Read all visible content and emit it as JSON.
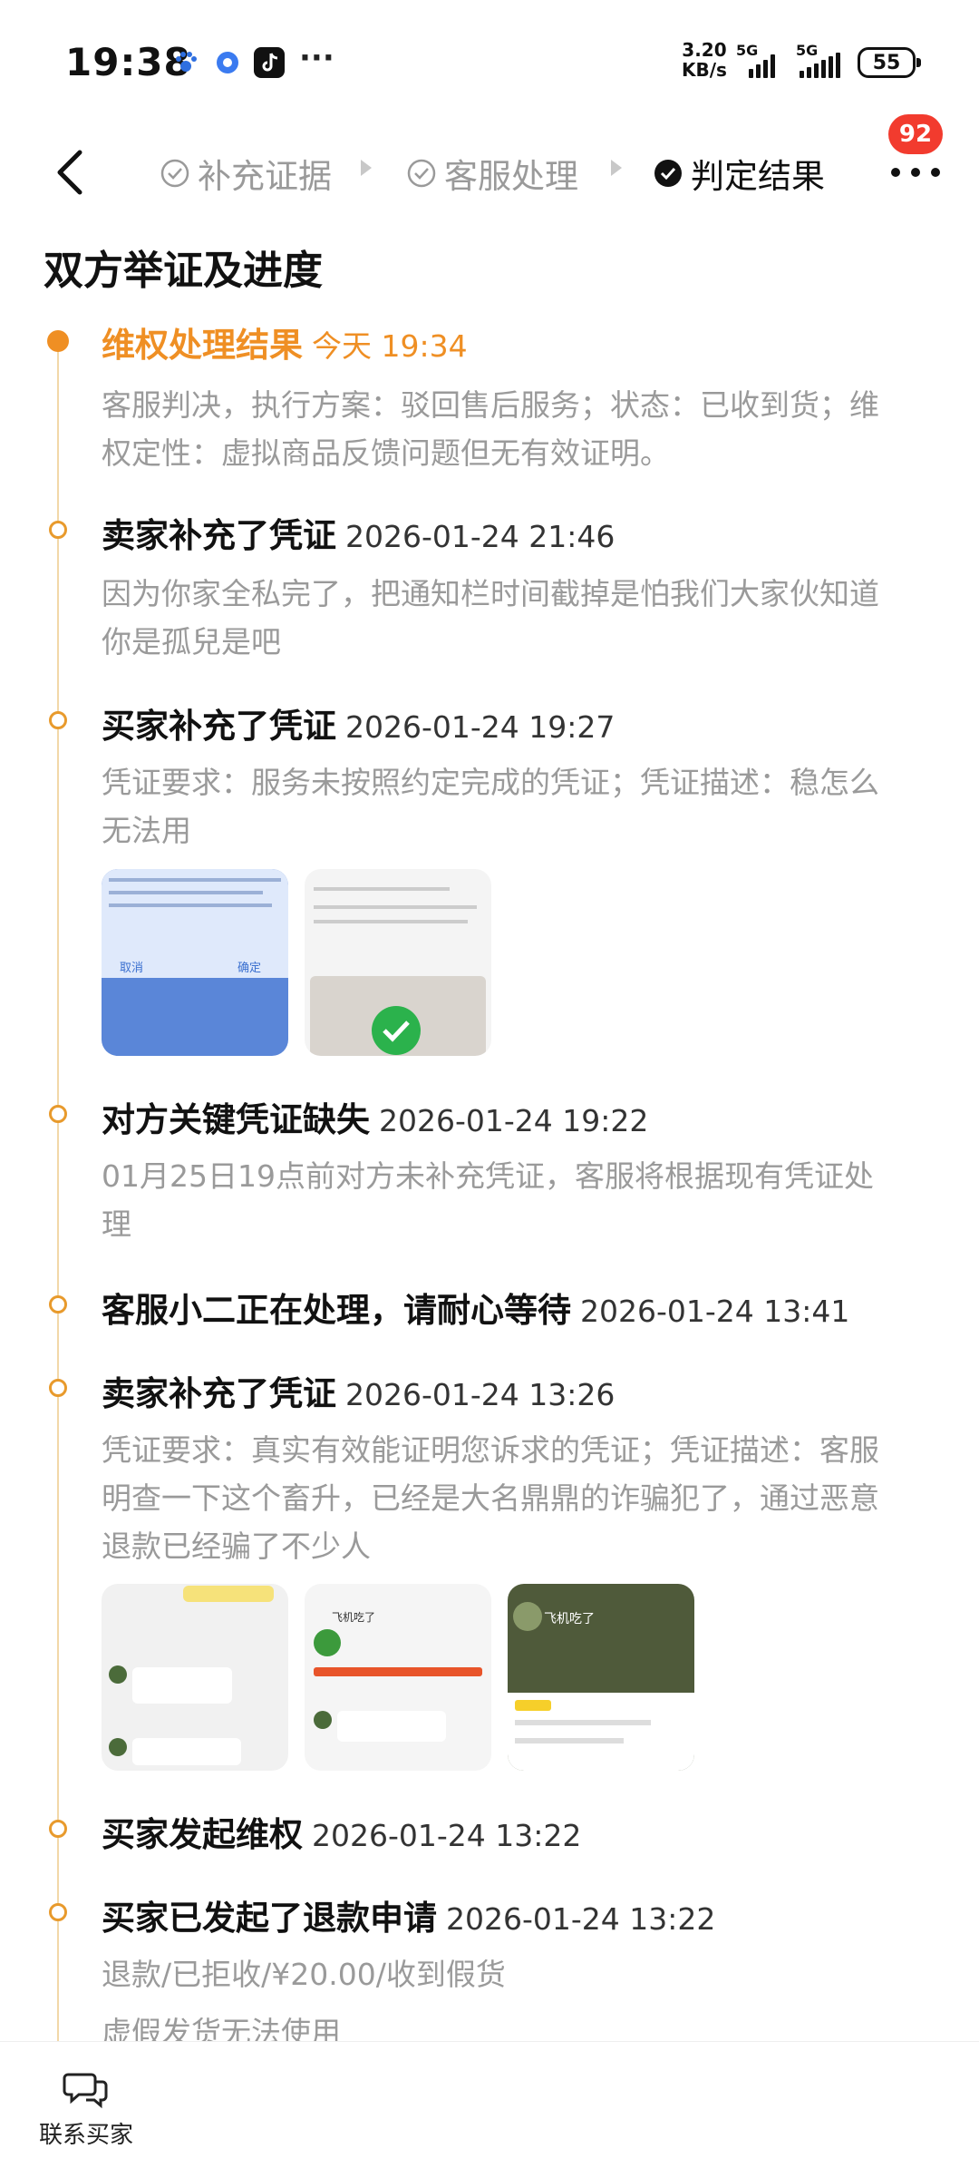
{
  "status_bar": {
    "time": "19:38",
    "net_speed_value": "3.20",
    "net_speed_unit": "KB/s",
    "sim1": "5G",
    "sim2": "5G",
    "battery": "55",
    "notification_icons": [
      "baidu-paw-icon",
      "circle-app-icon",
      "tiktok-icon",
      "more-icon"
    ]
  },
  "nav": {
    "steps": [
      {
        "label": "补充证据",
        "state": "done"
      },
      {
        "label": "客服处理",
        "state": "done"
      },
      {
        "label": "判定结果",
        "state": "active"
      }
    ],
    "message_badge": "92"
  },
  "section_title": "双方举证及进度",
  "events": [
    {
      "title": "维权处理结果",
      "time": "今天 19:34",
      "highlight": true,
      "desc": "客服判决，执行方案：驳回售后服务；状态：已收到货；维权定性：虚拟商品反馈问题但无有效证明。"
    },
    {
      "title": "卖家补充了凭证",
      "time": "2026-01-24 21:46",
      "desc": "因为你家全私完了，把通知栏时间截掉是怕我们大家伙知道你是孤兒是吧"
    },
    {
      "title": "买家补充了凭证",
      "time": "2026-01-24 19:27",
      "desc": "凭证要求：服务未按照约定完成的凭证；凭证描述：稳怎么无法用",
      "images": [
        {
          "name": "dialog-screenshot",
          "text": [
            "取消",
            "确定"
          ]
        },
        {
          "name": "app-screenshot",
          "text": []
        }
      ]
    },
    {
      "title": "对方关键凭证缺失",
      "time": "2026-01-24 19:22",
      "desc": "01月25日19点前对方未补充凭证，客服将根据现有凭证处理"
    },
    {
      "title": "客服小二正在处理，请耐心等待",
      "time": "2026-01-24 13:41",
      "desc": ""
    },
    {
      "title": "卖家补充了凭证",
      "time": "2026-01-24 13:26",
      "desc": "凭证要求：真实有效能证明您诉求的凭证；凭证描述：客服明查一下这个畜升，已经是大名鼎鼎的诈骗犯了，通过恶意退款已经骗了不少人",
      "images": [
        {
          "name": "chat-screenshot",
          "text": []
        },
        {
          "name": "order-screenshot",
          "text": [
            "飞机吃了"
          ]
        },
        {
          "name": "profile-screenshot",
          "text": [
            "飞机吃了"
          ]
        }
      ]
    },
    {
      "title": "买家发起维权",
      "time": "2026-01-24 13:22",
      "desc": ""
    },
    {
      "title": "买家已发起了退款申请",
      "time": "2026-01-24 13:22",
      "desc_lines": [
        "退款/已拒收/¥20.00/收到假货",
        "虚假发货无法使用"
      ]
    }
  ],
  "bottom": {
    "contact_label": "联系买家",
    "contact_icon": "chat-bubbles-icon"
  },
  "colors": {
    "accent": "#ef8f24",
    "timeline": "#f2d8a8",
    "muted_text": "#9a9a9a",
    "badge": "#f23b2e"
  }
}
